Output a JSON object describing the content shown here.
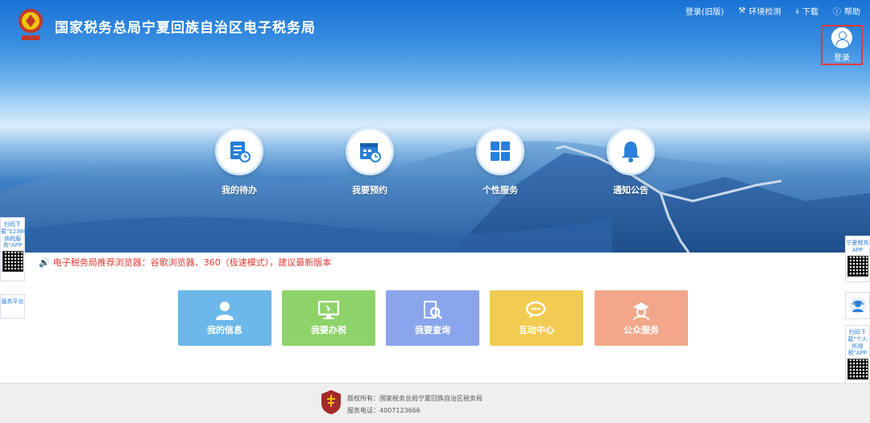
{
  "header": {
    "site_title": "国家税务总局宁夏回族自治区电子税务局",
    "logo_icon": "tax-emblem-icon",
    "links": [
      {
        "label": "登录(旧版)",
        "icon": ""
      },
      {
        "label": "环境检测",
        "icon": "tools-icon"
      },
      {
        "label": "下载",
        "icon": "download-icon"
      },
      {
        "label": "帮助",
        "icon": "help-icon"
      }
    ],
    "login_label": "登录"
  },
  "features": [
    {
      "label": "我的待办",
      "icon": "todo-list-icon"
    },
    {
      "label": "我要预约",
      "icon": "calendar-icon"
    },
    {
      "label": "个性服务",
      "icon": "grid-icon"
    },
    {
      "label": "通知公告",
      "icon": "bell-icon"
    }
  ],
  "notice": "电子税务局推荐浏览器：谷歌浏览器、360（极速模式），建议最新版本",
  "tiles": [
    {
      "label": "我的信息",
      "icon": "user-icon",
      "color": "#6cb8ea"
    },
    {
      "label": "我要办税",
      "icon": "monitor-icon",
      "color": "#8ed36a"
    },
    {
      "label": "我要查询",
      "icon": "search-doc-icon",
      "color": "#8ba5ec"
    },
    {
      "label": "互动中心",
      "icon": "chat-icon",
      "color": "#f2cc52"
    },
    {
      "label": "公众服务",
      "icon": "service-icon",
      "color": "#f2a78a"
    }
  ],
  "side_left": {
    "qr_text": "扫码下载\"12366纳税服务\"APP",
    "service_text": "服务平台"
  },
  "side_right": {
    "qr1_text": "宁夏税务APP",
    "qr2_text": "扫码下载\"个人所得税\"APP",
    "service_icon": "customer-service-icon"
  },
  "footer": {
    "copyright": "版权所有：国家税务总局宁夏回族自治区税务局",
    "phone": "服务电话：4007123666"
  }
}
